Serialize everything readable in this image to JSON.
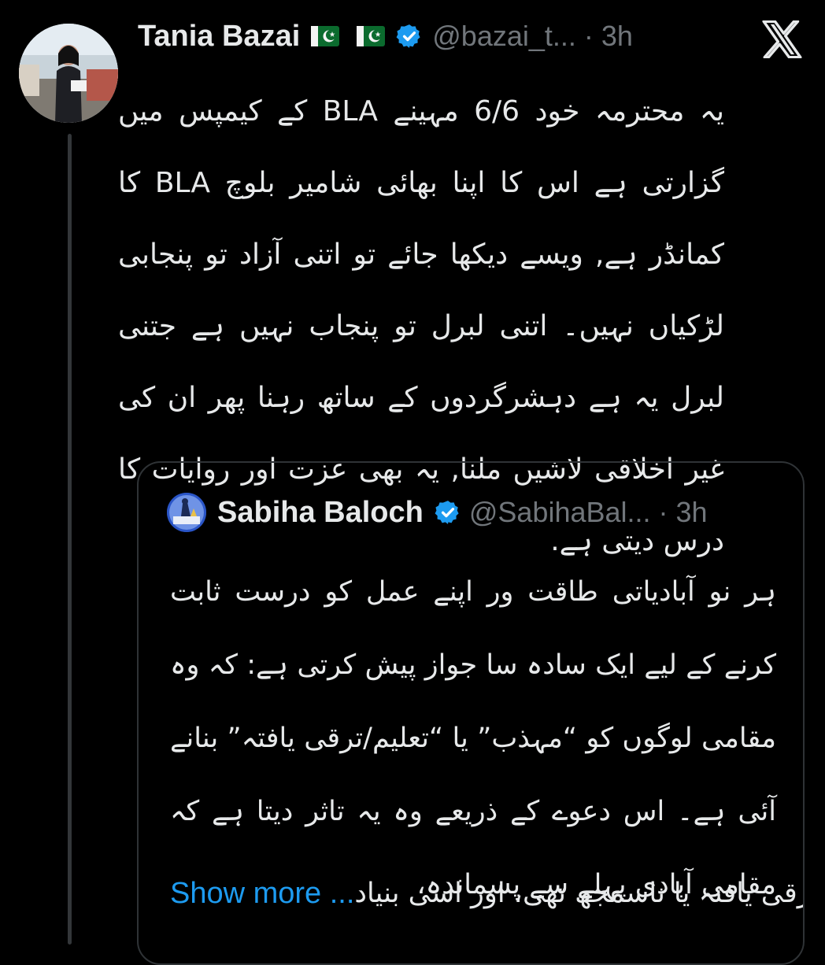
{
  "tweet": {
    "author_name": "Tania Bazai",
    "flags": [
      "🇵🇰",
      "🇵🇰"
    ],
    "handle": "@bazai_t...",
    "separator": " · ",
    "time": "3h",
    "text": "یہ محترمہ خود 6/6 مہینے BLA کے کیمپس میں گزارتی ہے اس کا اپنا بھائی شامیر بلوچ BLA کا کمانڈر ہے, ویسے دیکھا جائے تو اتنی آزاد تو پنجابی لڑکیاں نہیں۔ اتنی لبرل تو پنجاب نہیں ہے جتنی لبرل یہ ہے دہشرگردوں کے ساتھ رہنا پھر ان کی غیر اخلاقی لاشیں ملنا, یہ بھی عزت اور روایات کا درس دیتی ہے."
  },
  "quoted": {
    "author_name": "Sabiha Baloch",
    "handle": "@SabihaBal...",
    "separator": " · ",
    "time": "3h",
    "text": "ہر نو آبادیاتی طاقت ور اپنے عمل کو درست ثابت کرنے کے لیے ایک سادہ سا جواز پیش کرتی ہے: کہ وہ مقامی لوگوں کو “مہذب” یا “تعلیم/ترقی یافتہ” بنانے آئی ہے۔ اس دعوے کے ذریعے وہ یہ تاثر دیتا ہے کہ مقامی آبادی پہلے سے پسماندہ،",
    "last_line": "غیر ترقی یافتہ یا ناسمجھ تھی، اور اسی بنیاد",
    "show_more": "Show more ..."
  },
  "colors": {
    "background": "#000000",
    "text": "#e7e9ea",
    "muted": "#71767b",
    "link": "#1d9bf0",
    "verified": "#1d9bf0",
    "border": "#2f3336"
  },
  "icons": {
    "verified": "verified-badge-icon",
    "platform": "x-logo-icon"
  }
}
